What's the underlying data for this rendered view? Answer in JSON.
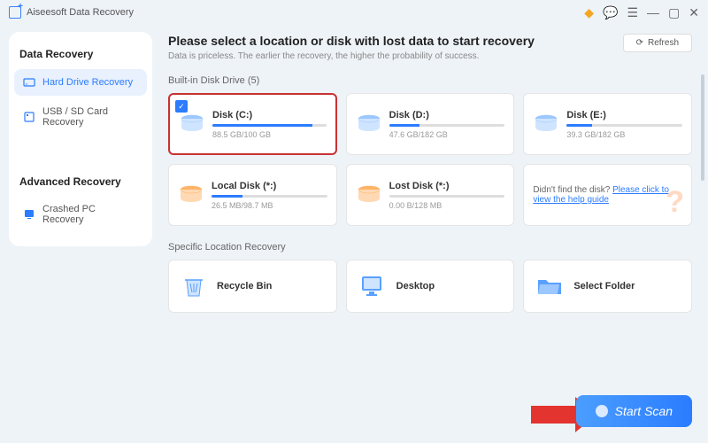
{
  "app": {
    "title": "Aiseesoft Data Recovery"
  },
  "sidebar": {
    "section1": "Data Recovery",
    "section2": "Advanced Recovery",
    "items": [
      {
        "label": "Hard Drive Recovery",
        "active": true
      },
      {
        "label": "USB / SD Card Recovery",
        "active": false
      },
      {
        "label": "Crashed PC Recovery",
        "active": false
      }
    ]
  },
  "content": {
    "heading": "Please select a location or disk with lost data to start recovery",
    "subtitle": "Data is priceless. The earlier the recovery, the higher the probability of success.",
    "refresh": "Refresh",
    "built_in_label": "Built-in Disk Drive (5)",
    "disks": [
      {
        "name": "Disk (C:)",
        "size": "88.5 GB/100 GB",
        "fill": 88,
        "selected": true
      },
      {
        "name": "Disk (D:)",
        "size": "47.6 GB/182 GB",
        "fill": 26,
        "selected": false
      },
      {
        "name": "Disk (E:)",
        "size": "39.3 GB/182 GB",
        "fill": 22,
        "selected": false
      },
      {
        "name": "Local Disk (*:)",
        "size": "26.5 MB/98.7 MB",
        "fill": 27,
        "selected": false
      },
      {
        "name": "Lost Disk (*:)",
        "size": "0.00 B/128 MB",
        "fill": 0,
        "selected": false
      }
    ],
    "help": {
      "text": "Didn't find the disk? ",
      "link": "Please click to view the help guide"
    },
    "specific_label": "Specific Location Recovery",
    "locations": [
      {
        "name": "Recycle Bin"
      },
      {
        "name": "Desktop"
      },
      {
        "name": "Select Folder"
      }
    ],
    "start_scan": "Start Scan"
  }
}
